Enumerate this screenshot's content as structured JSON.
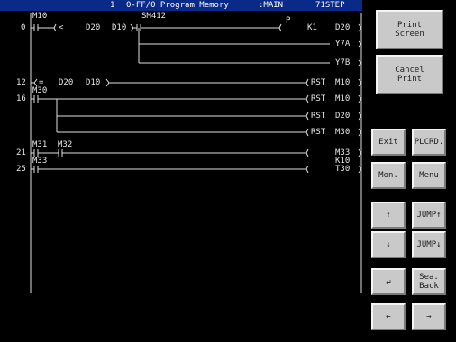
{
  "title_bar": {
    "num": "1",
    "name": "0-FF/0 Program Memory",
    "program": ":MAIN",
    "steps": "71STEP"
  },
  "ladder": {
    "step_numbers": [
      "0",
      "12",
      "16",
      "21",
      "25"
    ],
    "labels": {
      "m10": "M10",
      "cmp_op": "<",
      "d20a": "D20",
      "d10a": "D10",
      "sm412": "SM412",
      "p": "P",
      "k1": "K1",
      "d20b": "D20",
      "y7a": "Y7A",
      "y7b": "Y7B",
      "eq_op": "=",
      "d20c": "D20",
      "d10c": "D10",
      "m30": "M30",
      "rst1": "RST",
      "m10b": "M10",
      "rst2": "RST",
      "m10c": "M10",
      "rst3": "RST",
      "d20d": "D20",
      "rst4": "RST",
      "m30b": "M30",
      "m31": "M31",
      "m32": "M32",
      "m33a": "M33",
      "m33b": "M33",
      "k10": "K10",
      "t30": "T30"
    }
  },
  "buttons": {
    "print_screen": "Print\nScreen",
    "cancel_print": "Cancel\nPrint",
    "exit": "Exit",
    "plcrd": "PLCRD.",
    "mon": "Mon.",
    "menu": "Menu",
    "up": "↑",
    "jump_up": "JUMP↑",
    "down": "↓",
    "jump_down": "JUMP↓",
    "enter": "↵",
    "sea_back": "Sea.\nBack",
    "left": "←",
    "right": "→"
  }
}
